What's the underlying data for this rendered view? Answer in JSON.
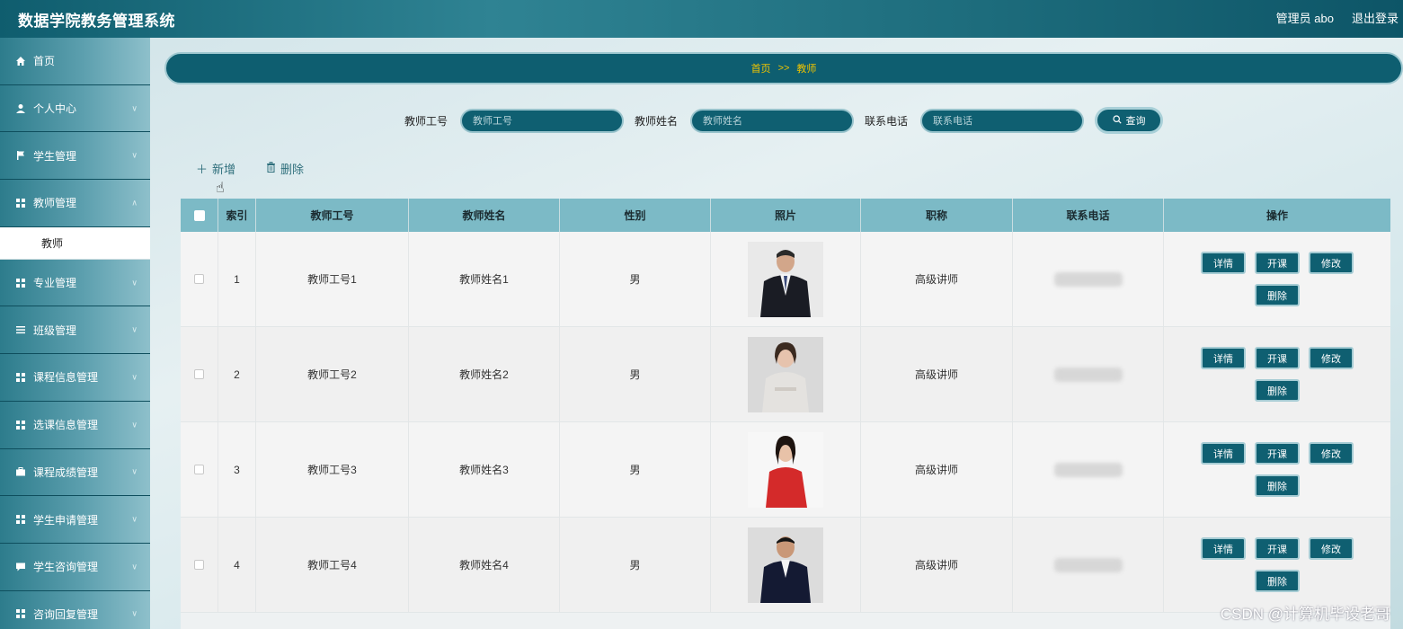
{
  "app": {
    "title": "数据学院教务管理系统"
  },
  "user": {
    "label": "管理员 abo",
    "logout": "退出登录"
  },
  "sidebar": {
    "items": [
      {
        "label": "首页",
        "icon": "home-icon",
        "expandable": false
      },
      {
        "label": "个人中心",
        "icon": "user-icon",
        "expandable": true
      },
      {
        "label": "学生管理",
        "icon": "flag-icon",
        "expandable": true
      },
      {
        "label": "教师管理",
        "icon": "grid-icon",
        "expandable": true,
        "submenu": [
          {
            "label": "教师"
          }
        ]
      },
      {
        "label": "专业管理",
        "icon": "grid-icon",
        "expandable": true
      },
      {
        "label": "班级管理",
        "icon": "list-icon",
        "expandable": true
      },
      {
        "label": "课程信息管理",
        "icon": "grid-icon",
        "expandable": true
      },
      {
        "label": "选课信息管理",
        "icon": "grid-icon",
        "expandable": true
      },
      {
        "label": "课程成绩管理",
        "icon": "briefcase-icon",
        "expandable": true
      },
      {
        "label": "学生申请管理",
        "icon": "grid-icon",
        "expandable": true
      },
      {
        "label": "学生咨询管理",
        "icon": "chat-icon",
        "expandable": true
      },
      {
        "label": "咨询回复管理",
        "icon": "grid-icon",
        "expandable": true
      }
    ]
  },
  "breadcrumb": {
    "home": "首页",
    "separator": ">>",
    "current": "教师"
  },
  "search": {
    "fields": [
      {
        "label": "教师工号",
        "placeholder": "教师工号"
      },
      {
        "label": "教师姓名",
        "placeholder": "教师姓名"
      },
      {
        "label": "联系电话",
        "placeholder": "联系电话"
      }
    ],
    "button": "查询"
  },
  "toolbar": {
    "add": "新增",
    "delete": "删除"
  },
  "table": {
    "headers": [
      "索引",
      "教师工号",
      "教师姓名",
      "性别",
      "照片",
      "职称",
      "联系电话",
      "操作"
    ],
    "rows": [
      {
        "index": "1",
        "no": "教师工号1",
        "name": "教师姓名1",
        "sex": "男",
        "title": "高级讲师",
        "photo": "male-suit-photo"
      },
      {
        "index": "2",
        "no": "教师工号2",
        "name": "教师姓名2",
        "sex": "男",
        "title": "高级讲师",
        "photo": "female-light-photo"
      },
      {
        "index": "3",
        "no": "教师工号3",
        "name": "教师姓名3",
        "sex": "男",
        "title": "高级讲师",
        "photo": "female-red-photo"
      },
      {
        "index": "4",
        "no": "教师工号4",
        "name": "教师姓名4",
        "sex": "男",
        "title": "高级讲师",
        "photo": "male-dark-photo"
      }
    ],
    "row_actions": [
      "详情",
      "开课",
      "修改",
      "删除"
    ]
  },
  "watermark": "CSDN @计算机毕设老哥",
  "colors": {
    "primary": "#0f5f71",
    "header": "#7cbac6",
    "breadcrumb_text": "#f0c400"
  }
}
